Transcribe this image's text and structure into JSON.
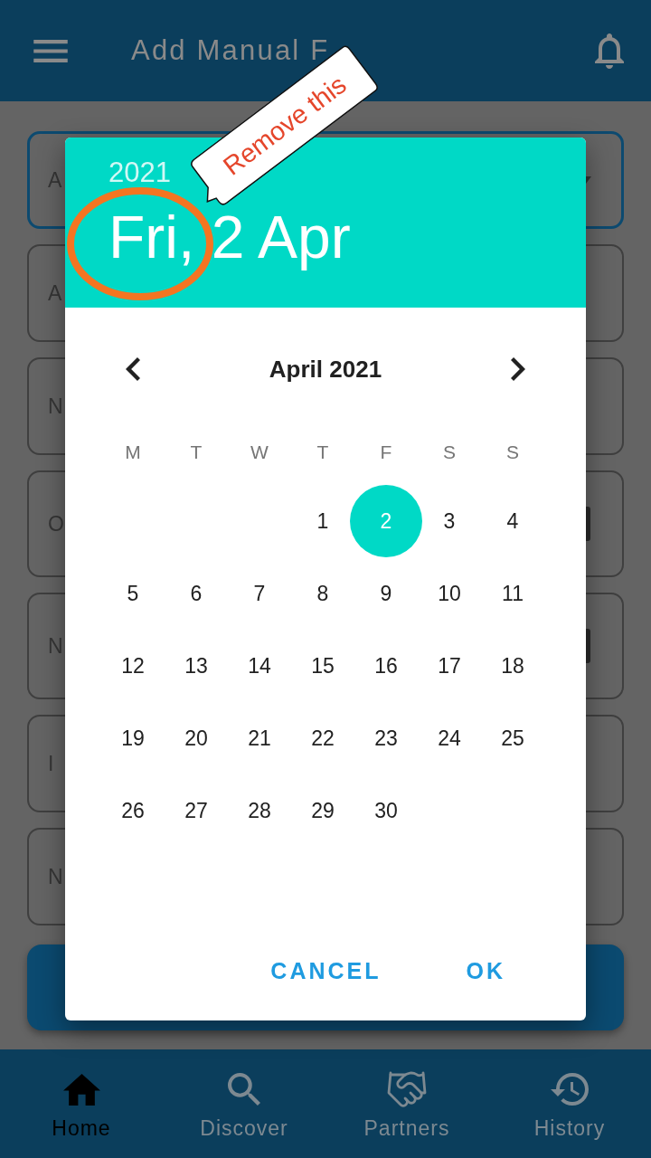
{
  "app_bar": {
    "title": "Add Manual F"
  },
  "form": {
    "fields": [
      {
        "kind": "dropdown",
        "label": "A",
        "focused": true
      },
      {
        "kind": "text",
        "label": "A",
        "focused": false
      },
      {
        "kind": "text",
        "label": "N",
        "focused": false
      },
      {
        "kind": "date",
        "label": "O",
        "focused": false
      },
      {
        "kind": "date",
        "label": "N",
        "focused": false
      },
      {
        "kind": "text",
        "label": "I",
        "focused": false
      },
      {
        "kind": "text",
        "label": "N",
        "focused": false
      }
    ]
  },
  "date_picker": {
    "year": "2021",
    "date": "Fri, 2 Apr",
    "month": "April 2021",
    "weekdays": [
      "M",
      "T",
      "W",
      "T",
      "F",
      "S",
      "S"
    ],
    "weeks": [
      [
        {
          "kind": "blank"
        },
        {
          "kind": "blank"
        },
        {
          "kind": "blank"
        },
        {
          "kind": "day",
          "label": "1",
          "selected": false
        },
        {
          "kind": "day",
          "label": "2",
          "selected": true
        },
        {
          "kind": "day",
          "label": "3",
          "selected": false
        },
        {
          "kind": "day",
          "label": "4",
          "selected": false
        }
      ],
      [
        {
          "kind": "day",
          "label": "5",
          "selected": false
        },
        {
          "kind": "day",
          "label": "6",
          "selected": false
        },
        {
          "kind": "day",
          "label": "7",
          "selected": false
        },
        {
          "kind": "day",
          "label": "8",
          "selected": false
        },
        {
          "kind": "day",
          "label": "9",
          "selected": false
        },
        {
          "kind": "day",
          "label": "10",
          "selected": false
        },
        {
          "kind": "day",
          "label": "11",
          "selected": false
        }
      ],
      [
        {
          "kind": "day",
          "label": "12",
          "selected": false
        },
        {
          "kind": "day",
          "label": "13",
          "selected": false
        },
        {
          "kind": "day",
          "label": "14",
          "selected": false
        },
        {
          "kind": "day",
          "label": "15",
          "selected": false
        },
        {
          "kind": "day",
          "label": "16",
          "selected": false
        },
        {
          "kind": "day",
          "label": "17",
          "selected": false
        },
        {
          "kind": "day",
          "label": "18",
          "selected": false
        }
      ],
      [
        {
          "kind": "day",
          "label": "19",
          "selected": false
        },
        {
          "kind": "day",
          "label": "20",
          "selected": false
        },
        {
          "kind": "day",
          "label": "21",
          "selected": false
        },
        {
          "kind": "day",
          "label": "22",
          "selected": false
        },
        {
          "kind": "day",
          "label": "23",
          "selected": false
        },
        {
          "kind": "day",
          "label": "24",
          "selected": false
        },
        {
          "kind": "day",
          "label": "25",
          "selected": false
        }
      ],
      [
        {
          "kind": "day",
          "label": "26",
          "selected": false
        },
        {
          "kind": "day",
          "label": "27",
          "selected": false
        },
        {
          "kind": "day",
          "label": "28",
          "selected": false
        },
        {
          "kind": "day",
          "label": "29",
          "selected": false
        },
        {
          "kind": "day",
          "label": "30",
          "selected": false
        }
      ]
    ],
    "buttons": [
      "CANCEL",
      "OK"
    ]
  },
  "bottom_nav": {
    "items": [
      {
        "label": "Home",
        "selected": true
      },
      {
        "label": "Discover",
        "selected": false
      },
      {
        "label": "Partners",
        "selected": false
      },
      {
        "label": "History",
        "selected": false
      }
    ]
  },
  "annotations": [
    {
      "kind": "ellipse"
    },
    {
      "kind": "callout",
      "text": "Remove this"
    }
  ]
}
